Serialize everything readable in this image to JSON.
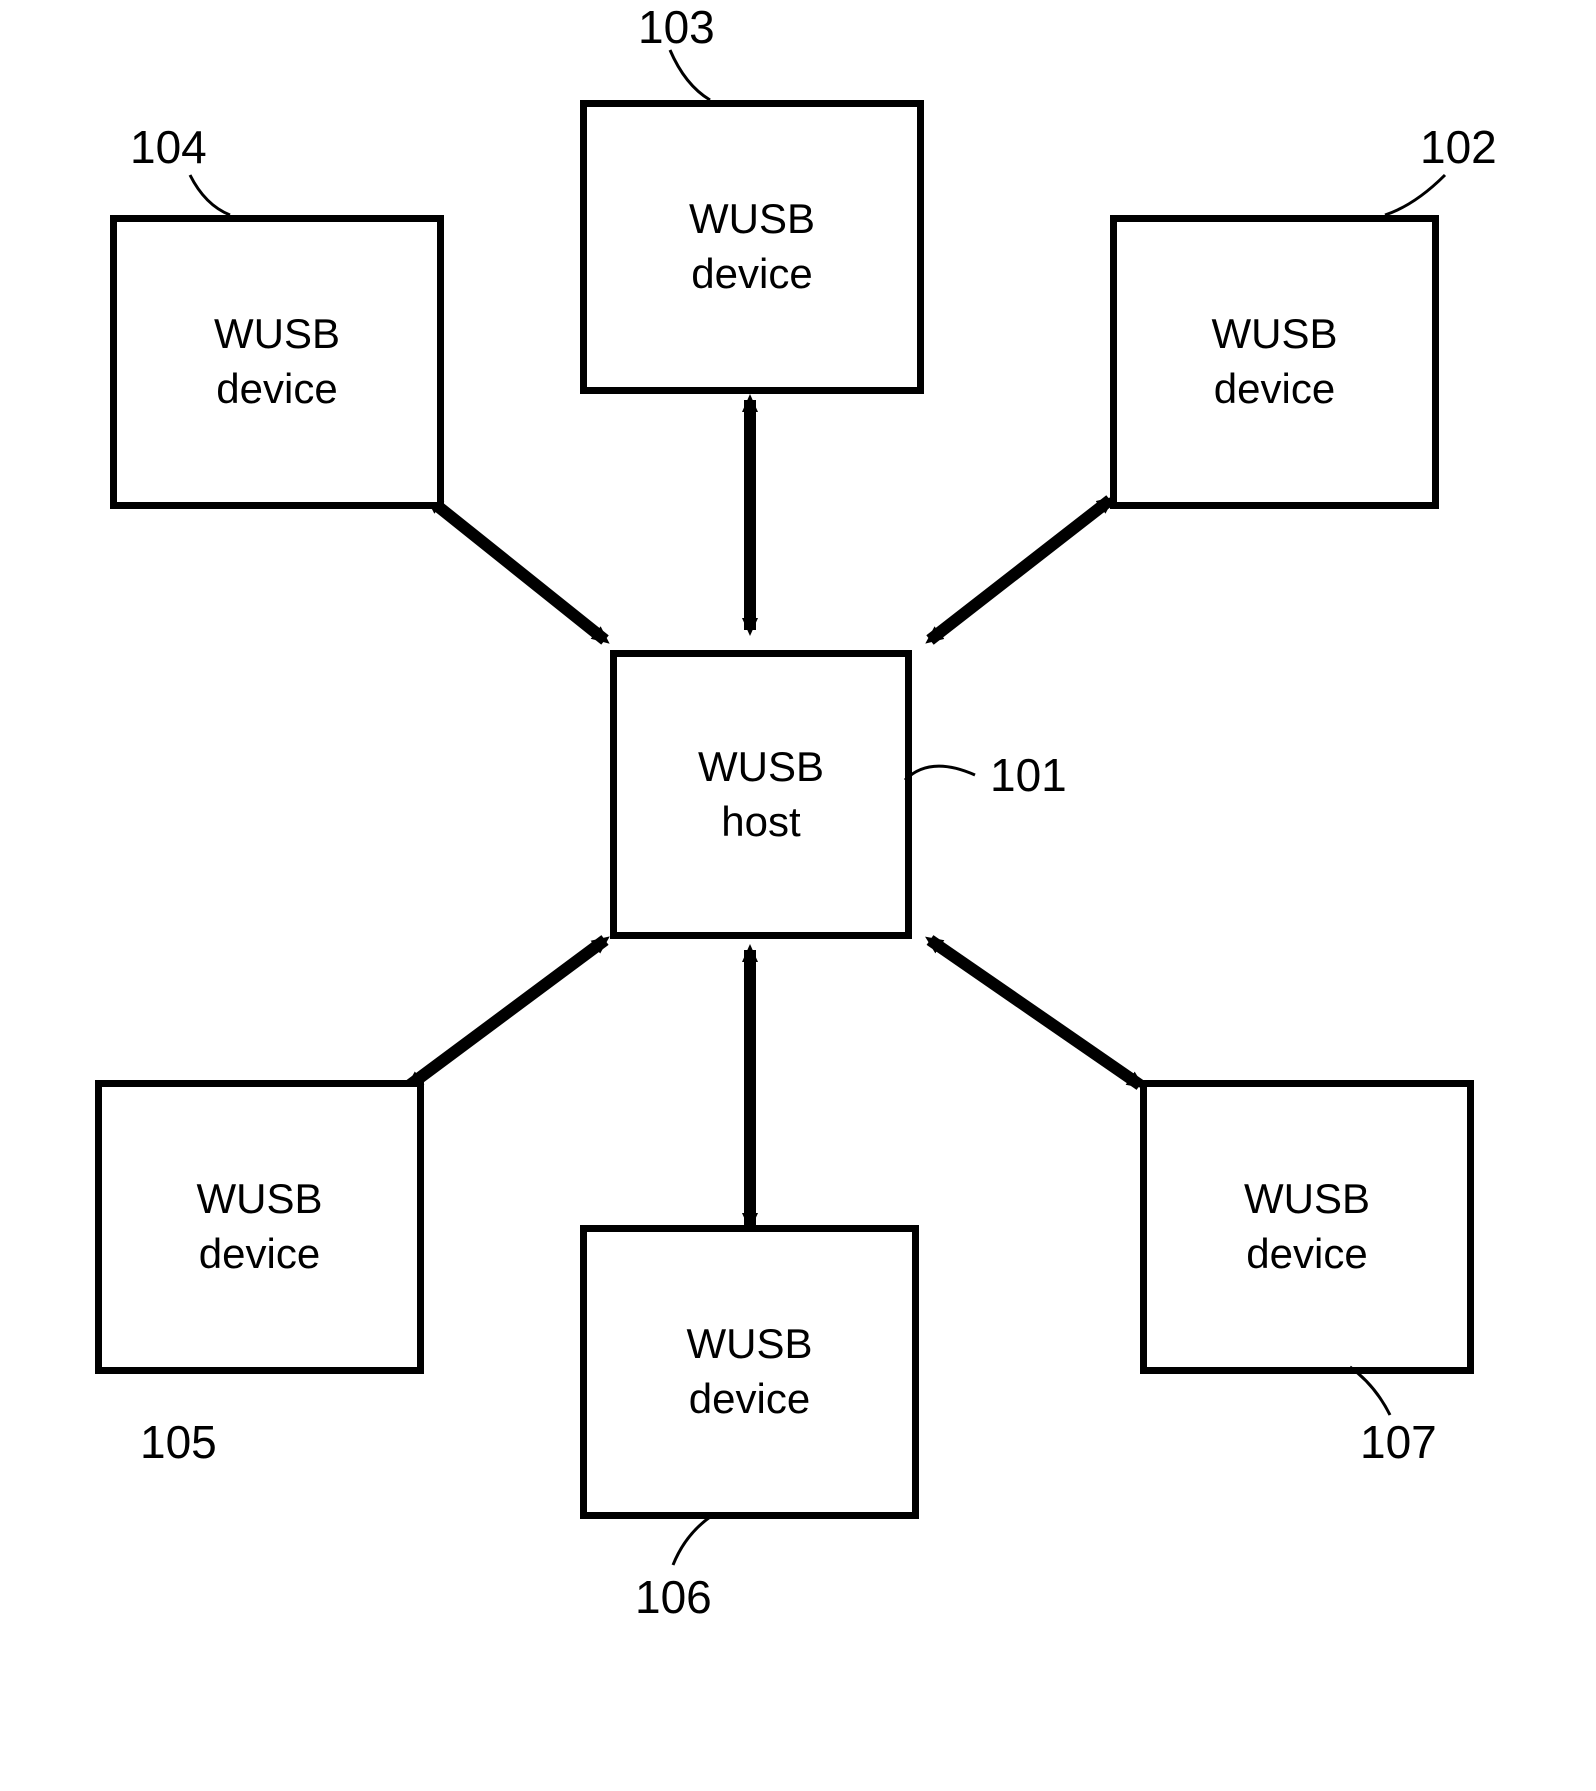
{
  "diagram": {
    "host": {
      "line1": "WUSB",
      "line2": "host",
      "label": "101"
    },
    "devices": {
      "top_right": {
        "line1": "WUSB",
        "line2": "device",
        "label": "102"
      },
      "top": {
        "line1": "WUSB",
        "line2": "device",
        "label": "103"
      },
      "top_left": {
        "line1": "WUSB",
        "line2": "device",
        "label": "104"
      },
      "bottom_left": {
        "line1": "WUSB",
        "line2": "device",
        "label": "105"
      },
      "bottom": {
        "line1": "WUSB",
        "line2": "device",
        "label": "106"
      },
      "bottom_right": {
        "line1": "WUSB",
        "line2": "device",
        "label": "107"
      }
    }
  }
}
